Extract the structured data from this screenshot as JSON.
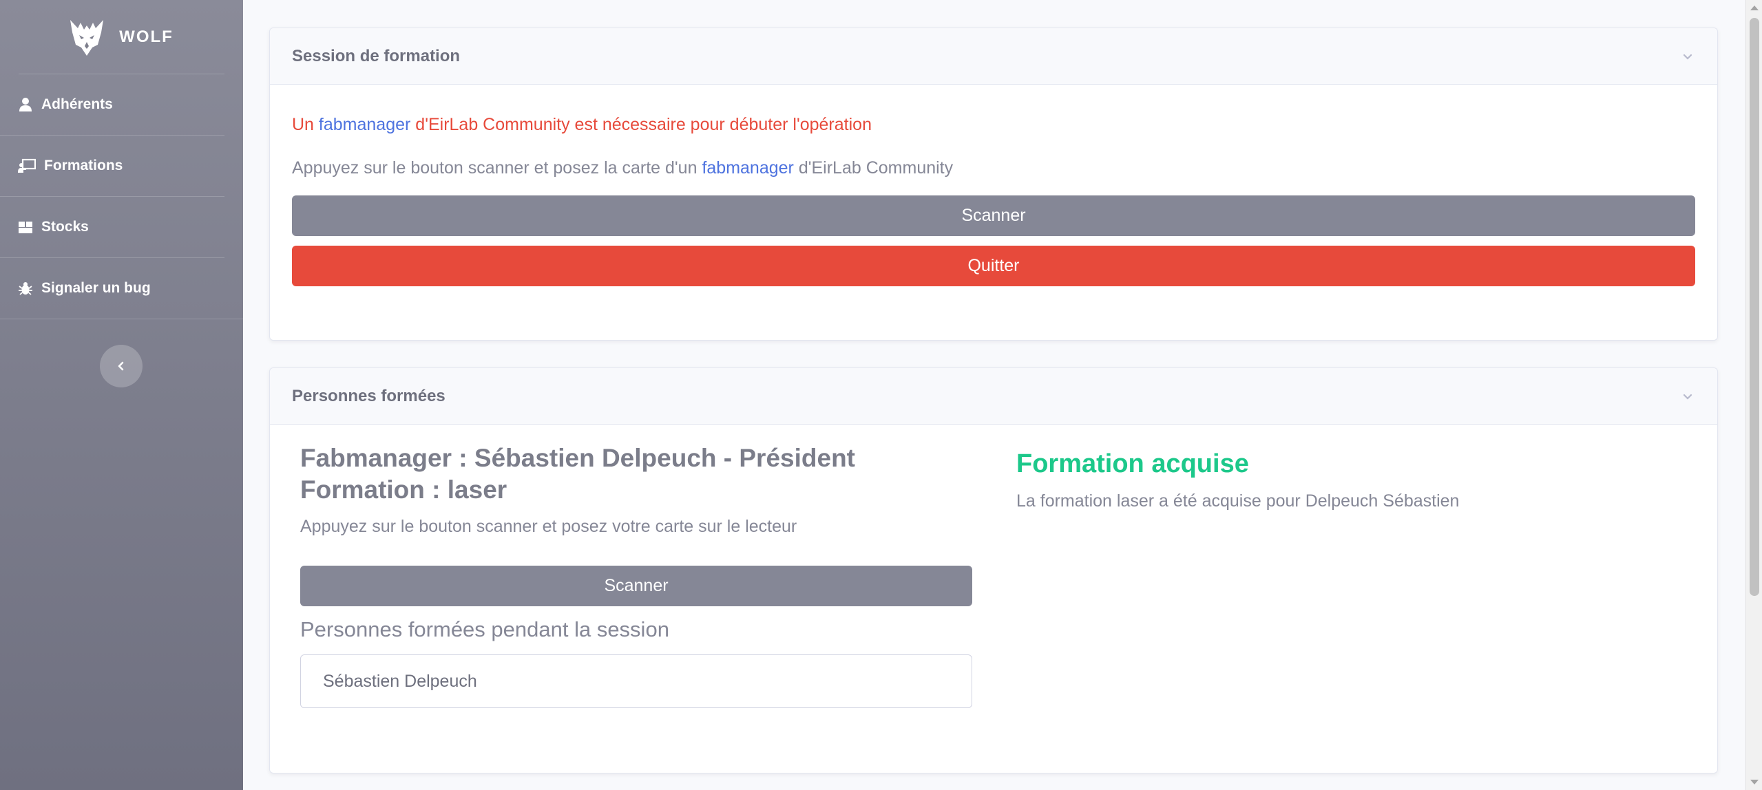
{
  "brand": {
    "name": "WOLF",
    "icon": "wolf-logo-icon"
  },
  "sidebar": {
    "items": [
      {
        "label": "Adhérents",
        "icon": "user-icon"
      },
      {
        "label": "Formations",
        "icon": "chalkboard-teacher-icon"
      },
      {
        "label": "Stocks",
        "icon": "boxes-icon"
      },
      {
        "label": "Signaler un bug",
        "icon": "bug-icon"
      }
    ],
    "toggle_icon": "chevron-left-icon"
  },
  "session_card": {
    "title": "Session de formation",
    "warning": {
      "prefix": "Un ",
      "link": "fabmanager",
      "suffix": " d'EirLab Community est nécessaire pour débuter l'opération"
    },
    "instruction": {
      "prefix": "Appuyez sur le bouton scanner et posez la carte d'un ",
      "link": "fabmanager",
      "suffix": " d'EirLab Community"
    },
    "scan_label": "Scanner",
    "quit_label": "Quitter"
  },
  "trained_card": {
    "title": "Personnes formées",
    "fabmanager_line": "Fabmanager : Sébastien Delpeuch - Président",
    "formation_line": "Formation : laser",
    "instruction": "Appuyez sur le bouton scanner et posez votre carte sur le lecteur",
    "scan_label": "Scanner",
    "list_title": "Personnes formées pendant la session",
    "trained_people": [
      "Sébastien Delpeuch"
    ],
    "success_title": "Formation acquise",
    "success_message": "La formation laser a été acquise pour Delpeuch Sébastien"
  },
  "colors": {
    "sidebar_top": "#8a8b99",
    "sidebar_bottom": "#6f7080",
    "danger": "#e74a3b",
    "success": "#1cc88a",
    "link": "#4e73df",
    "secondary": "#858796"
  }
}
